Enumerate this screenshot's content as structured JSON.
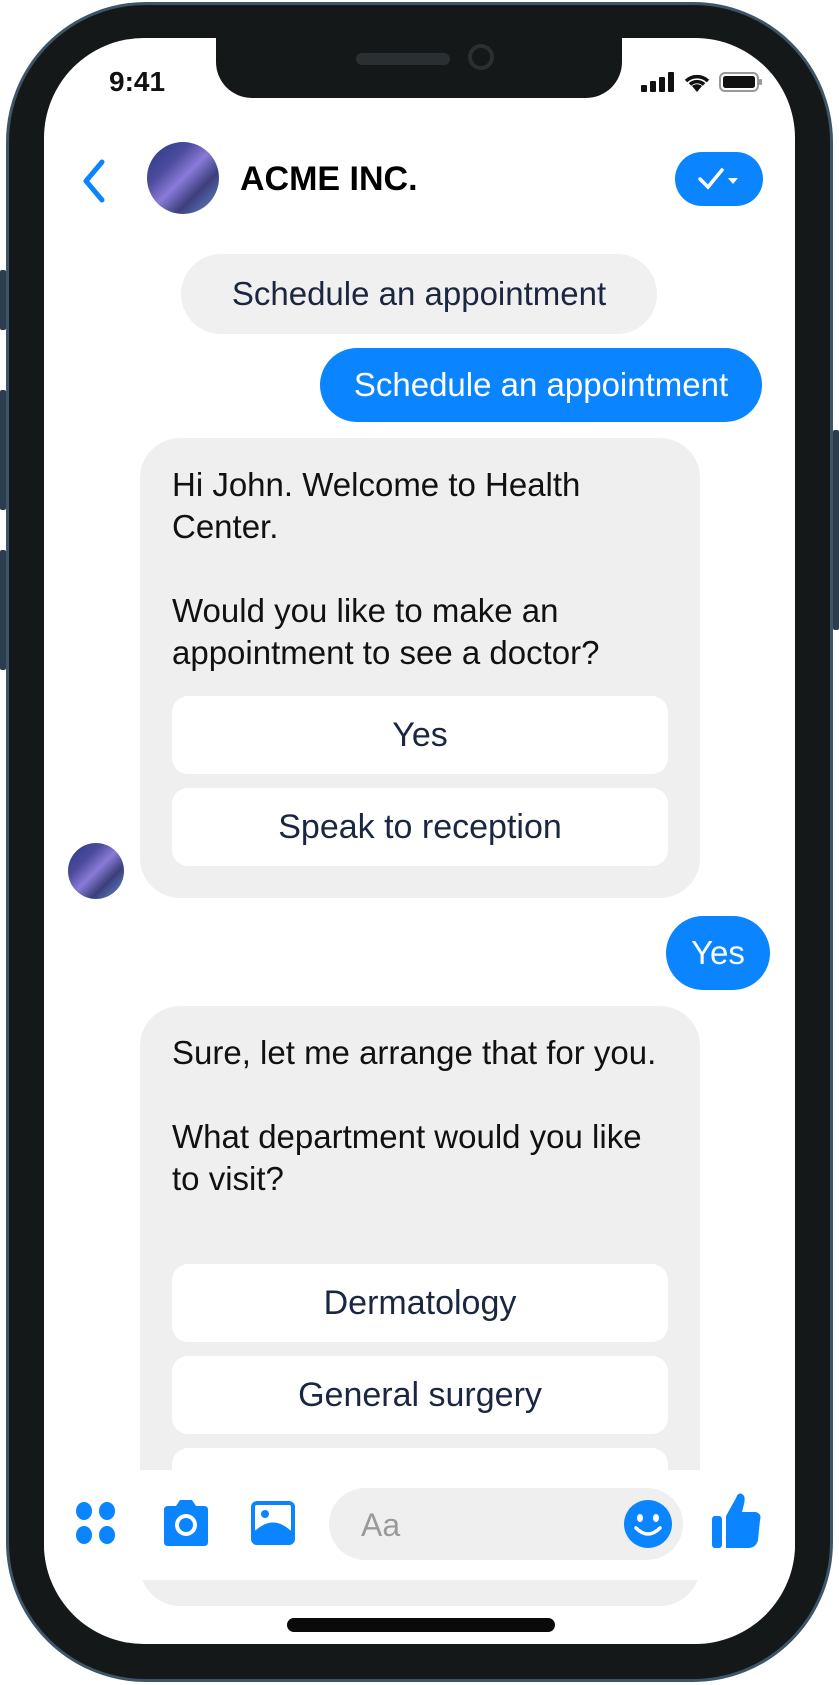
{
  "status_bar": {
    "time": "9:41"
  },
  "header": {
    "title": "ACME INC.",
    "back_icon": "chevron-left-icon",
    "verify_icon": "checkmark-dropdown-icon"
  },
  "colors": {
    "accent": "#0a84ff",
    "bubble_grey": "#efefef",
    "frame": "#141819"
  },
  "messages": [
    {
      "type": "suggestion",
      "text": "Schedule an appointment"
    },
    {
      "type": "sent",
      "text": "Schedule an appointment"
    },
    {
      "type": "received",
      "lines": [
        "Hi John. Welcome to Health Center.",
        "Would you like to make an appointment to see a doctor?"
      ],
      "quick_replies": [
        "Yes",
        "Speak to reception"
      ]
    },
    {
      "type": "sent",
      "text": "Yes"
    },
    {
      "type": "received",
      "lines": [
        "Sure, let me arrange that for you.",
        "What department would you like to visit?"
      ],
      "quick_replies": [
        "Dermatology",
        "General surgery",
        ""
      ]
    }
  ],
  "composer": {
    "placeholder": "Aa",
    "icons": [
      "apps-icon",
      "camera-icon",
      "image-icon",
      "emoji-icon",
      "thumbs-up-icon"
    ]
  }
}
